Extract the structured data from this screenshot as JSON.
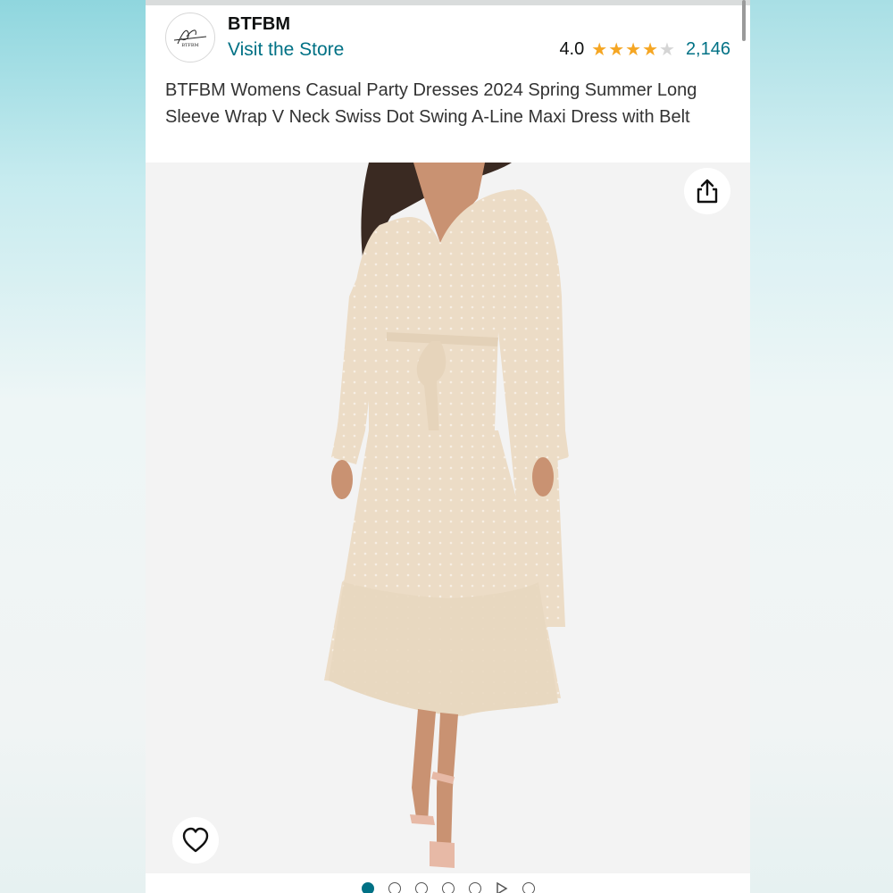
{
  "product": {
    "brand": "BTFBM",
    "logo_text": "BTFBM",
    "store_link": "Visit the Store",
    "rating_value": "4.0",
    "rating_stars": 4,
    "rating_max": 5,
    "review_count": "2,146",
    "title": "BTFBM Womens Casual Party Dresses 2024 Spring Summer Long Sleeve Wrap V Neck Swiss Dot Swing A-Line Maxi Dress with Belt"
  },
  "gallery": {
    "image_count": 7,
    "active_index": 0,
    "video_index": 5
  },
  "icons": {
    "share": "share-icon",
    "heart": "heart-icon",
    "star": "star-icon",
    "video": "play-icon"
  },
  "colors": {
    "link": "#007185",
    "star": "#f5a623",
    "dress": "#ecdcc6"
  }
}
